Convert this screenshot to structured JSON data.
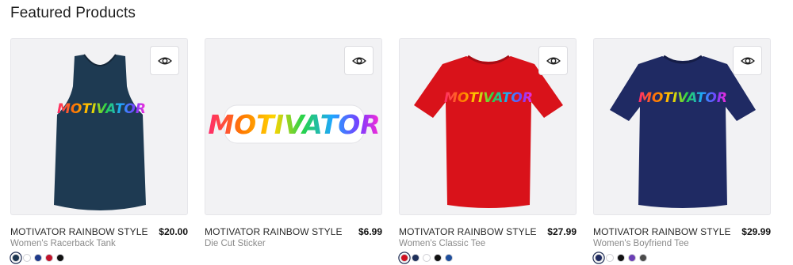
{
  "section": {
    "title": "Featured Products"
  },
  "products": [
    {
      "title": "MOTIVATOR RAINBOW STYLE",
      "subtitle": "Women's Racerback Tank",
      "price": "$20.00",
      "graphic_text": "MOTIVATOR",
      "product_color": "#1e3a52",
      "swatches": [
        "#1c3550",
        "#ffffff",
        "#1f3a8a",
        "#c2132b",
        "#111111"
      ]
    },
    {
      "title": "MOTIVATOR RAINBOW STYLE",
      "subtitle": "Die Cut Sticker",
      "price": "$6.99",
      "graphic_text": "MOTIVATOR",
      "product_color": "#ffffff",
      "swatches": []
    },
    {
      "title": "MOTIVATOR RAINBOW STYLE",
      "subtitle": "Women's Classic Tee",
      "price": "$27.99",
      "graphic_text": "MOTIVATOR",
      "product_color": "#d9121a",
      "swatches": [
        "#cf1020",
        "#1e2f5a",
        "#ffffff",
        "#111111",
        "#1f4f9c"
      ]
    },
    {
      "title": "MOTIVATOR RAINBOW STYLE",
      "subtitle": "Women's Boyfriend Tee",
      "price": "$29.99",
      "graphic_text": "MOTIVATOR",
      "product_color": "#1f2a63",
      "swatches": [
        "#1e2a60",
        "#ffffff",
        "#111111",
        "#6b3fb5",
        "#4b4b4b"
      ]
    }
  ]
}
